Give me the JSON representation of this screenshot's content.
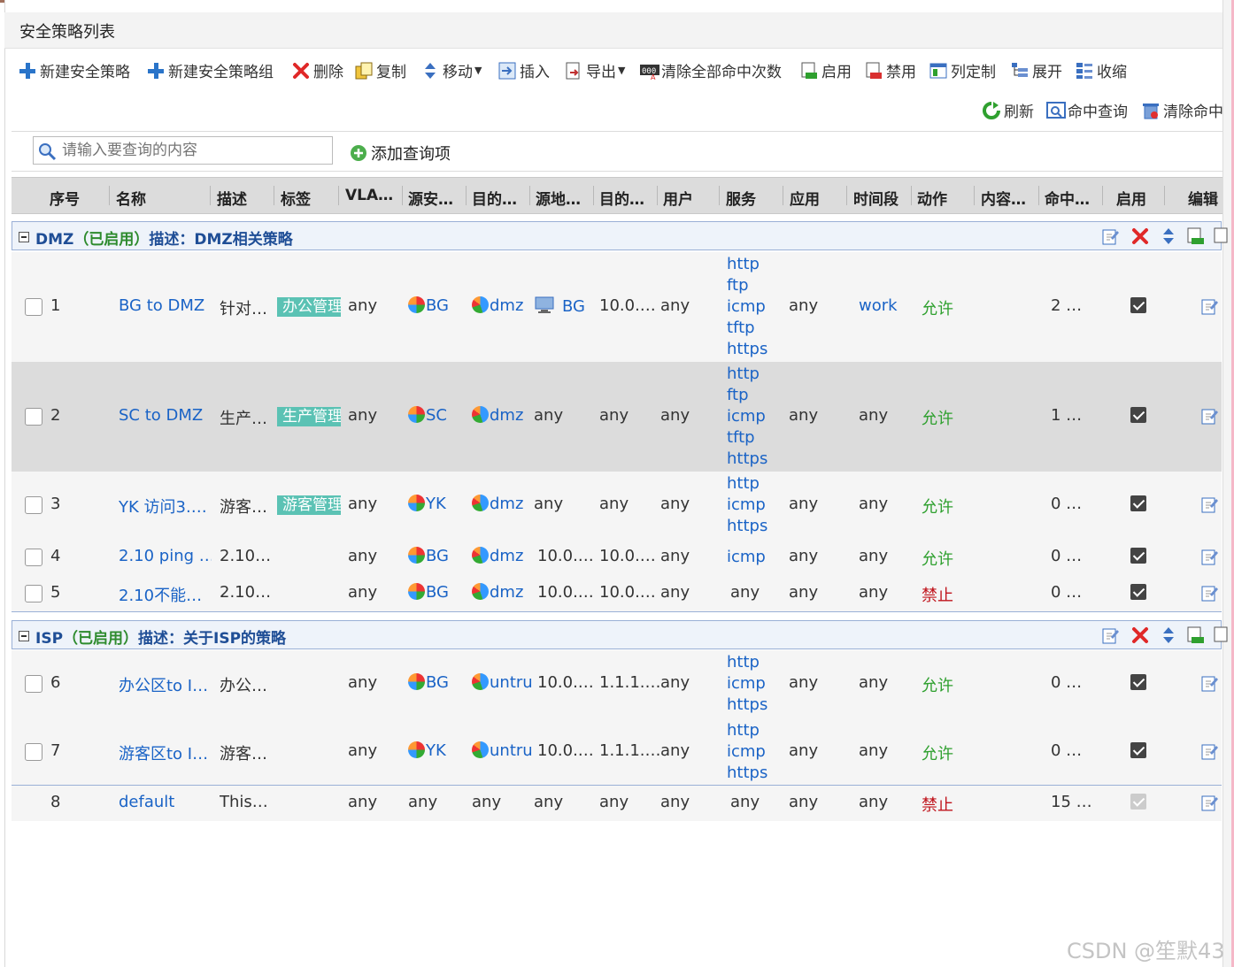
{
  "panel_title": "安全策略列表",
  "toolbar": {
    "new_policy": "新建安全策略",
    "new_group": "新建安全策略组",
    "delete": "删除",
    "copy": "复制",
    "move": "移动",
    "insert": "插入",
    "export": "导出",
    "clear_hits": "清除全部命中次数",
    "enable": "启用",
    "disable": "禁用",
    "columns": "列定制",
    "expand": "展开",
    "collapse": "收缩",
    "refresh": "刷新",
    "hit_query": "命中查询",
    "clear_hit_partial": "清除命中"
  },
  "search": {
    "placeholder": "请输入要查询的内容",
    "add_query": "添加查询项"
  },
  "columns": [
    "序号",
    "名称",
    "描述",
    "标签",
    "VLA…",
    "源安…",
    "目的…",
    "源地…",
    "目的…",
    "用户",
    "服务",
    "应用",
    "时间段",
    "动作",
    "内容…",
    "命中…",
    "启用",
    "编辑"
  ],
  "groups": [
    {
      "name": "DMZ",
      "status": "（已启用）",
      "desc": "描述：DMZ相关策略"
    },
    {
      "name": "ISP",
      "status": "（已启用）",
      "desc": "描述：关于ISP的策略"
    }
  ],
  "rows": [
    {
      "id": "1",
      "name": "BG to DMZ",
      "desc": "针对…",
      "tag": "办公管理",
      "vlan": "any",
      "src_zone": "BG",
      "dst_zone": "dmz",
      "src_addr": "BG",
      "dst_addr": "10.0.…",
      "user": "any",
      "services": [
        "http",
        "ftp",
        "icmp",
        "tftp",
        "https"
      ],
      "app": "any",
      "time": "work",
      "action": "允许",
      "content": "",
      "hits": "2 …"
    },
    {
      "id": "2",
      "name": "SC to DMZ",
      "desc": "生产…",
      "tag": "生产管理",
      "vlan": "any",
      "src_zone": "SC",
      "dst_zone": "dmz",
      "src_addr": "any",
      "dst_addr": "any",
      "user": "any",
      "services": [
        "http",
        "ftp",
        "icmp",
        "tftp",
        "https"
      ],
      "app": "any",
      "time": "any",
      "action": "允许",
      "content": "",
      "hits": "1 …"
    },
    {
      "id": "3",
      "name": "YK 访问3.…",
      "desc": "游客…",
      "tag": "游客管理",
      "vlan": "any",
      "src_zone": "YK",
      "dst_zone": "dmz",
      "src_addr": "any",
      "dst_addr": "any",
      "user": "any",
      "services": [
        "http",
        "icmp",
        "https"
      ],
      "app": "any",
      "time": "any",
      "action": "允许",
      "content": "",
      "hits": "0 …"
    },
    {
      "id": "4",
      "name": "2.10 ping …",
      "desc": "2.10…",
      "tag": "",
      "vlan": "any",
      "src_zone": "BG",
      "dst_zone": "dmz",
      "src_addr": "10.0.…",
      "dst_addr": "10.0.…",
      "user": "any",
      "services": [
        "icmp"
      ],
      "app": "any",
      "time": "any",
      "action": "允许",
      "content": "",
      "hits": "0 …"
    },
    {
      "id": "5",
      "name": "2.10不能…",
      "desc": "2.10…",
      "tag": "",
      "vlan": "any",
      "src_zone": "BG",
      "dst_zone": "dmz",
      "src_addr": "10.0.…",
      "dst_addr": "10.0.…",
      "user": "any",
      "services_text": "any",
      "app": "any",
      "time": "any",
      "action": "禁止",
      "content": "",
      "hits": "0 …"
    },
    {
      "id": "6",
      "name": "办公区to I…",
      "desc": "办公…",
      "tag": "",
      "vlan": "any",
      "src_zone": "BG",
      "dst_zone": "untrus",
      "src_addr": "10.0.…",
      "dst_addr": "1.1.1.…",
      "user": "any",
      "services": [
        "http",
        "icmp",
        "https"
      ],
      "app": "any",
      "time": "any",
      "action": "允许",
      "content": "",
      "hits": "0 …"
    },
    {
      "id": "7",
      "name": "游客区to I…",
      "desc": "游客…",
      "tag": "",
      "vlan": "any",
      "src_zone": "YK",
      "dst_zone": "untrus",
      "src_addr": "10.0.…",
      "dst_addr": "1.1.1.…",
      "user": "any",
      "services": [
        "http",
        "icmp",
        "https"
      ],
      "app": "any",
      "time": "any",
      "action": "允许",
      "content": "",
      "hits": "0 …"
    },
    {
      "id": "8",
      "name": "default",
      "desc": "This…",
      "tag": "",
      "vlan": "any",
      "src_zone": "any",
      "dst_zone": "any",
      "src_addr": "any",
      "dst_addr": "any",
      "user": "any",
      "services_text": "any",
      "app": "any",
      "time": "any",
      "action": "禁止",
      "content": "",
      "hits": "15 …"
    }
  ],
  "watermark": "CSDN @笙默43",
  "colors": {
    "allow": "#2fa02f",
    "deny": "#c0141c",
    "link": "#1a63c6",
    "tag": "#5bc2b4",
    "group_bg": "#eef3fa"
  }
}
